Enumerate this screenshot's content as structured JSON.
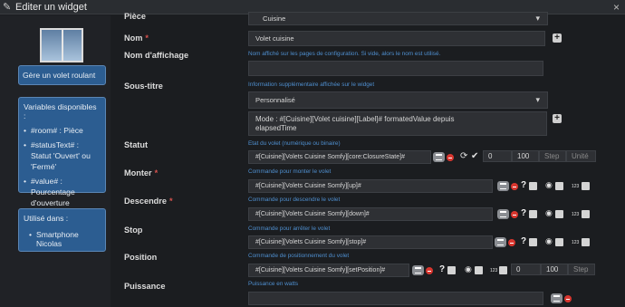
{
  "window": {
    "title": "Editer un widget"
  },
  "sidebar": {
    "card1": "Gère un volet roulant",
    "card2_title": "Variables disponibles :",
    "card2_items": [
      "#room# : Pièce",
      "#statusText# : Statut 'Ouvert' ou 'Fermé'",
      "#value# : Pourcentage d'ouverture"
    ],
    "card3_title": "Utilisé dans :",
    "card3_items": [
      "Smartphone Nicolas"
    ]
  },
  "form": {
    "piece": {
      "label": "Pièce",
      "value": "Cuisine"
    },
    "nom": {
      "label": "Nom",
      "value": "Volet cuisine"
    },
    "affichage": {
      "label": "Nom d'affichage",
      "help": "Nom affiché sur les pages de configuration. Si vide, alors le nom est utilisé.",
      "value": ""
    },
    "soustitre": {
      "label": "Sous-titre",
      "help": "Information supplémentaire affichée sur le widget",
      "select": "Personnalisé",
      "text": "Mode : #[Cuisine][Volet cuisine][Label]# formatedValue depuis elapsedTime"
    },
    "statut": {
      "label": "Statut",
      "help": "Etat du volet (numérique ou binaire)",
      "value": "#[Cuisine][Volets Cuisine Somfy][core:ClosureState]#",
      "min": "0",
      "max": "100",
      "step_ph": "Step",
      "unit_ph": "Unité"
    },
    "monter": {
      "label": "Monter",
      "help": "Commande pour monter le volet",
      "value": "#[Cuisine][Volets Cuisine Somfy][up]#"
    },
    "descendre": {
      "label": "Descendre",
      "help": "Commande pour descendre le volet",
      "value": "#[Cuisine][Volets Cuisine Somfy][down]#"
    },
    "stop": {
      "label": "Stop",
      "help": "Commande pour arrêter le volet",
      "value": "#[Cuisine][Volets Cuisine Somfy][stop]#"
    },
    "position": {
      "label": "Position",
      "help": "Commande de positionnement du volet",
      "value": "#[Cuisine][Volets Cuisine Somfy][setPosition]#",
      "min": "0",
      "max": "100",
      "step_ph": "Step"
    },
    "puissance": {
      "label": "Puissance",
      "help": "Puissance en watts",
      "value": ""
    },
    "required_mark": "*",
    "qmark": "?",
    "num_label": "123"
  },
  "icons": {
    "edit": "pencil-icon",
    "close": "close-icon",
    "list": "list-icon",
    "delete": "delete-icon",
    "refresh": "refresh-icon",
    "check": "check-icon",
    "eye": "eye-icon"
  }
}
